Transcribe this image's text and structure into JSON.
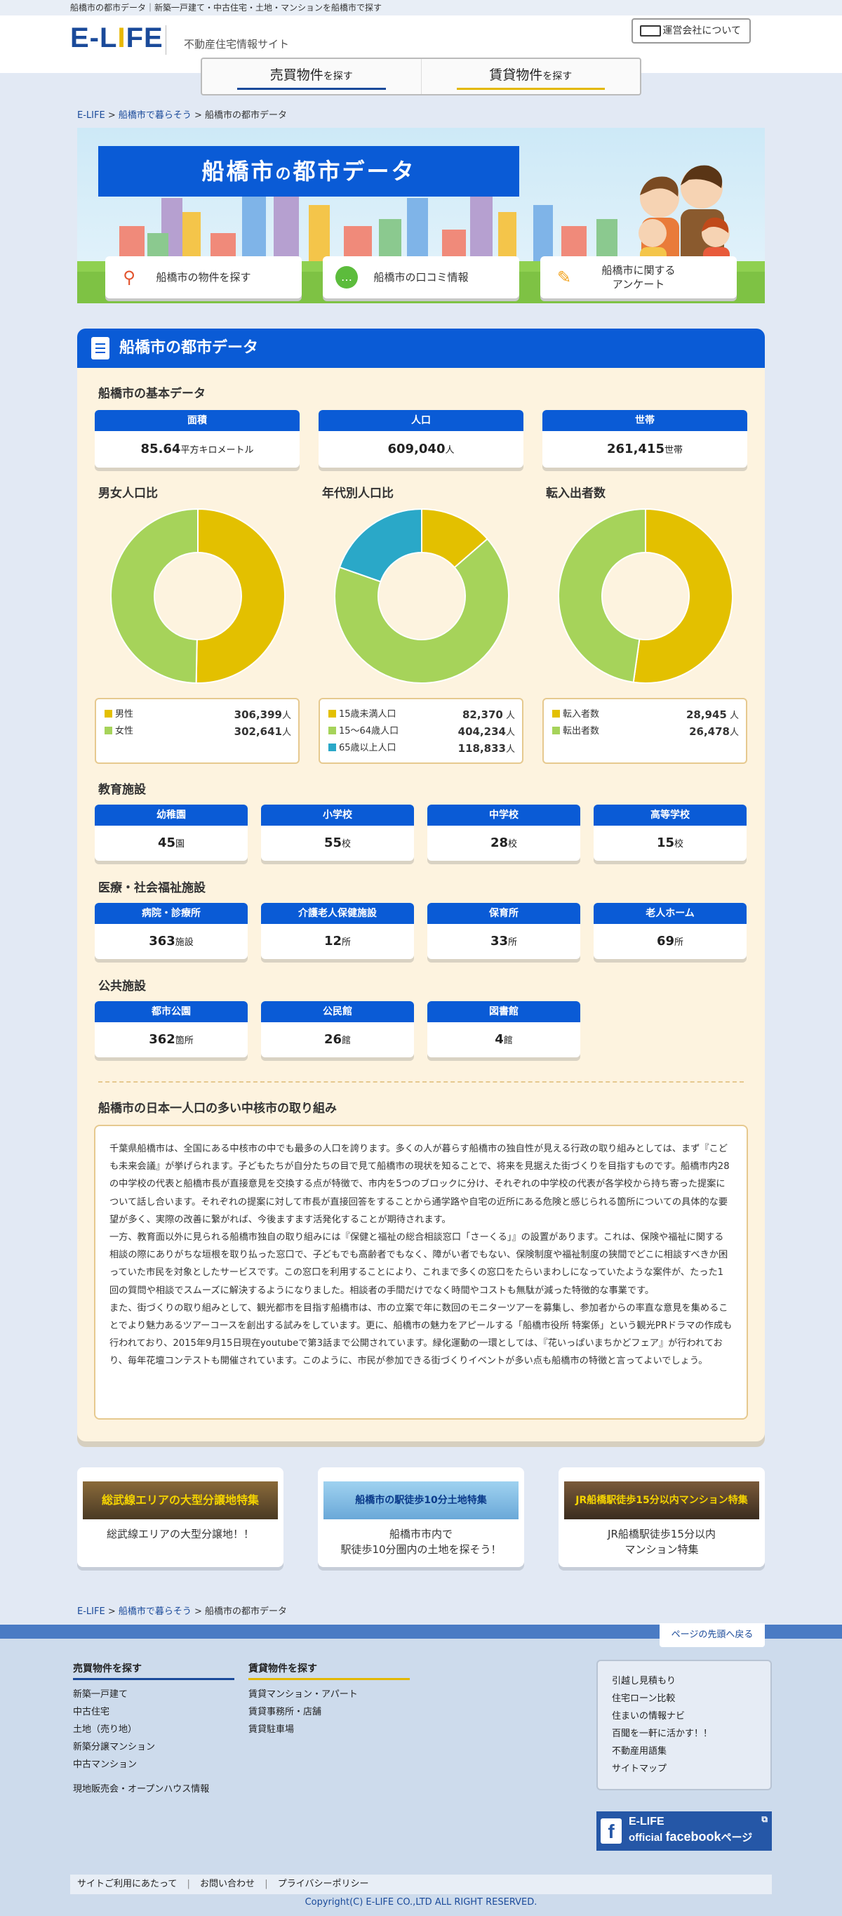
{
  "topline": "船橋市の都市データ｜新築一戸建て・中古住宅・土地・マンションを船橋市で探す",
  "header": {
    "logo": "E-LIFE",
    "subtitle": "不動産住宅情報サイト",
    "company_link": "運営会社について"
  },
  "nav": {
    "buy": {
      "main": "売買物件",
      "suffix": "を探す"
    },
    "rent": {
      "main": "賃貸物件",
      "suffix": "を探す"
    }
  },
  "breadcrumb": {
    "home": "E-LIFE",
    "sep": " > ",
    "parent": "船橋市で暮らそう",
    "current": "船橋市の都市データ"
  },
  "hero": {
    "title_main": "船橋市",
    "title_no": "の",
    "title_rest": "都市データ",
    "buttons": [
      {
        "label": "船橋市の物件を探す"
      },
      {
        "label": "船橋市の口コミ情報"
      },
      {
        "label_1": "船橋市に関する",
        "label_2": "アンケート"
      }
    ]
  },
  "panel": {
    "title": "船橋市の都市データ",
    "basic_title": "船橋市の基本データ",
    "basic": [
      {
        "label": "面積",
        "value": "85.64",
        "unit": "平方キロメートル"
      },
      {
        "label": "人口",
        "value": "609,040",
        "unit": "人"
      },
      {
        "label": "世帯",
        "value": "261,415",
        "unit": "世帯"
      }
    ],
    "charts": [
      {
        "title": "男女人口比",
        "rows": [
          {
            "name": "男性",
            "value": "306,399",
            "unit": "人"
          },
          {
            "name": "女性",
            "value": "302,641",
            "unit": "人"
          }
        ]
      },
      {
        "title": "年代別人口比",
        "rows": [
          {
            "name": "15歳未満人口",
            "value": "82,370",
            "unit": " 人"
          },
          {
            "name": "15～64歳人口",
            "value": "404,234",
            "unit": "人"
          },
          {
            "name": "65歳以上人口",
            "value": "118,833",
            "unit": "人"
          }
        ]
      },
      {
        "title": "転入出者数",
        "rows": [
          {
            "name": "転入者数",
            "value": "28,945",
            "unit": " 人"
          },
          {
            "name": "転出者数",
            "value": "26,478",
            "unit": "人"
          }
        ]
      }
    ],
    "edu_title": "教育施設",
    "edu": [
      {
        "label": "幼稚園",
        "value": "45",
        "unit": "園"
      },
      {
        "label": "小学校",
        "value": "55",
        "unit": "校"
      },
      {
        "label": "中学校",
        "value": "28",
        "unit": "校"
      },
      {
        "label": "高等学校",
        "value": "15",
        "unit": "校"
      }
    ],
    "med_title": "医療・社会福祉施設",
    "med": [
      {
        "label": "病院・診療所",
        "value": "363",
        "unit": "施設"
      },
      {
        "label": "介護老人保健施設",
        "value": "12",
        "unit": "所"
      },
      {
        "label": "保育所",
        "value": "33",
        "unit": "所"
      },
      {
        "label": "老人ホーム",
        "value": "69",
        "unit": "所"
      }
    ],
    "pub_title": "公共施設",
    "pub": [
      {
        "label": "都市公園",
        "value": "362",
        "unit": "箇所"
      },
      {
        "label": "公民館",
        "value": "26",
        "unit": "館"
      },
      {
        "label": "図書館",
        "value": "4",
        "unit": "館"
      }
    ],
    "essay_title": "船橋市の日本一人口の多い中核市の取り組み",
    "essay": [
      "千葉県船橋市は、全国にある中核市の中でも最多の人口を誇ります。多くの人が暮らす船橋市の独自性が見える行政の取り組みとしては、まず『こども未来会議』が挙げられます。子どもたちが自分たちの目で見て船橋市の現状を知ることで、将来を見据えた街づくりを目指すものです。船橋市内28の中学校の代表と船橋市長が直接意見を交換する点が特徴で、市内を5つのブロックに分け、それぞれの中学校の代表が各学校から持ち寄った提案について話し合います。それぞれの提案に対して市長が直接回答をすることから通学路や自宅の近所にある危険と感じられる箇所についての具体的な要望が多く、実際の改善に繋がれば、今後ますます活発化することが期待されます。",
      "一方、教育面以外に見られる船橋市独自の取り組みには『保健と福祉の総合相談窓口「さーくる」』の設置があります。これは、保険や福祉に関する相談の際にありがちな垣根を取り払った窓口で、子どもでも高齢者でもなく、障がい者でもない、保険制度や福祉制度の狭間でどこに相談すべきか困っていた市民を対象としたサービスです。この窓口を利用することにより、これまで多くの窓口をたらいまわしになっていたような案件が、たった1回の質問や相談でスムーズに解決するようになりました。相談者の手間だけでなく時間やコストも無駄が減った特徴的な事業です。",
      "また、街づくりの取り組みとして、観光都市を目指す船橋市は、市の立案で年に数回のモニターツアーを募集し、参加者からの率直な意見を集めることでより魅力あるツアーコースを創出する試みをしています。更に、船橋市の魅力をアピールする「船橋市役所 特案係」という観光PRドラマの作成も行われており、2015年9月15日現在youtubeで第3話まで公開されています。緑化運動の一環としては、『花いっぱいまちかどフェア』が行われており、毎年花壇コンテストも開催されています。このように、市民が参加できる街づくりイベントが多い点も船橋市の特徴と言ってよいでしょう。"
    ]
  },
  "promos": [
    {
      "banner": "総武線エリアの大型分譲地特集",
      "label_1": "総武線エリアの大型分譲地！！",
      "label_2": ""
    },
    {
      "banner": "船橋市の駅徒歩10分土地特集",
      "label_1": "船橋市市内で",
      "label_2": "駅徒歩10分圏内の土地を探そう！"
    },
    {
      "banner": "JR船橋駅徒歩15分以内マンション特集",
      "label_1": "JR船橋駅徒歩15分以内",
      "label_2": "マンション特集"
    }
  ],
  "footer": {
    "to_top": "ページの先頭へ戻る",
    "buy_title": "売買物件を探す",
    "buy_links": [
      "新築一戸建て",
      "中古住宅",
      "土地（売り地）",
      "新築分譲マンション",
      "中古マンション"
    ],
    "open_house": "現地販売会・オープンハウス情報",
    "rent_title": "賃貸物件を探す",
    "rent_links": [
      "賃貸マンション・アパート",
      "賃貸事務所・店舗",
      "賃貸駐車場"
    ],
    "side_links": [
      "引越し見積もり",
      "住宅ローン比較",
      "住まいの情報ナビ",
      "百聞を一軒に活かす！！",
      "不動産用語集",
      "サイトマップ"
    ],
    "fb_line1": "E-LIFE",
    "fb_line2a": "official ",
    "fb_line2b": "facebook",
    "fb_line2c": "ページ",
    "bottom_links": [
      "サイトご利用にあたって",
      "お問い合わせ",
      "プライバシーポリシー"
    ],
    "copyright": "Copyright(C) E-LIFE CO.,LTD ALL RIGHT RESERVED."
  },
  "chart_data": [
    {
      "type": "pie",
      "title": "男女人口比",
      "categories": [
        "男性",
        "女性"
      ],
      "values": [
        306399,
        302641
      ],
      "colors": [
        "#e3c000",
        "#a6d35a"
      ]
    },
    {
      "type": "pie",
      "title": "年代別人口比",
      "categories": [
        "15歳未満人口",
        "15～64歳人口",
        "65歳以上人口"
      ],
      "values": [
        82370,
        404234,
        118833
      ],
      "colors": [
        "#e3c000",
        "#a6d35a",
        "#2aa8c8"
      ]
    },
    {
      "type": "pie",
      "title": "転入出者数",
      "categories": [
        "転入者数",
        "転出者数"
      ],
      "values": [
        28945,
        26478
      ],
      "colors": [
        "#e3c000",
        "#a6d35a"
      ]
    }
  ],
  "colors": {
    "brand_blue": "#0a5bd6",
    "nav_blue_line": "#1a4a9a",
    "nav_yellow_line": "#e3b800",
    "panel_bg": "#fdf3df"
  }
}
